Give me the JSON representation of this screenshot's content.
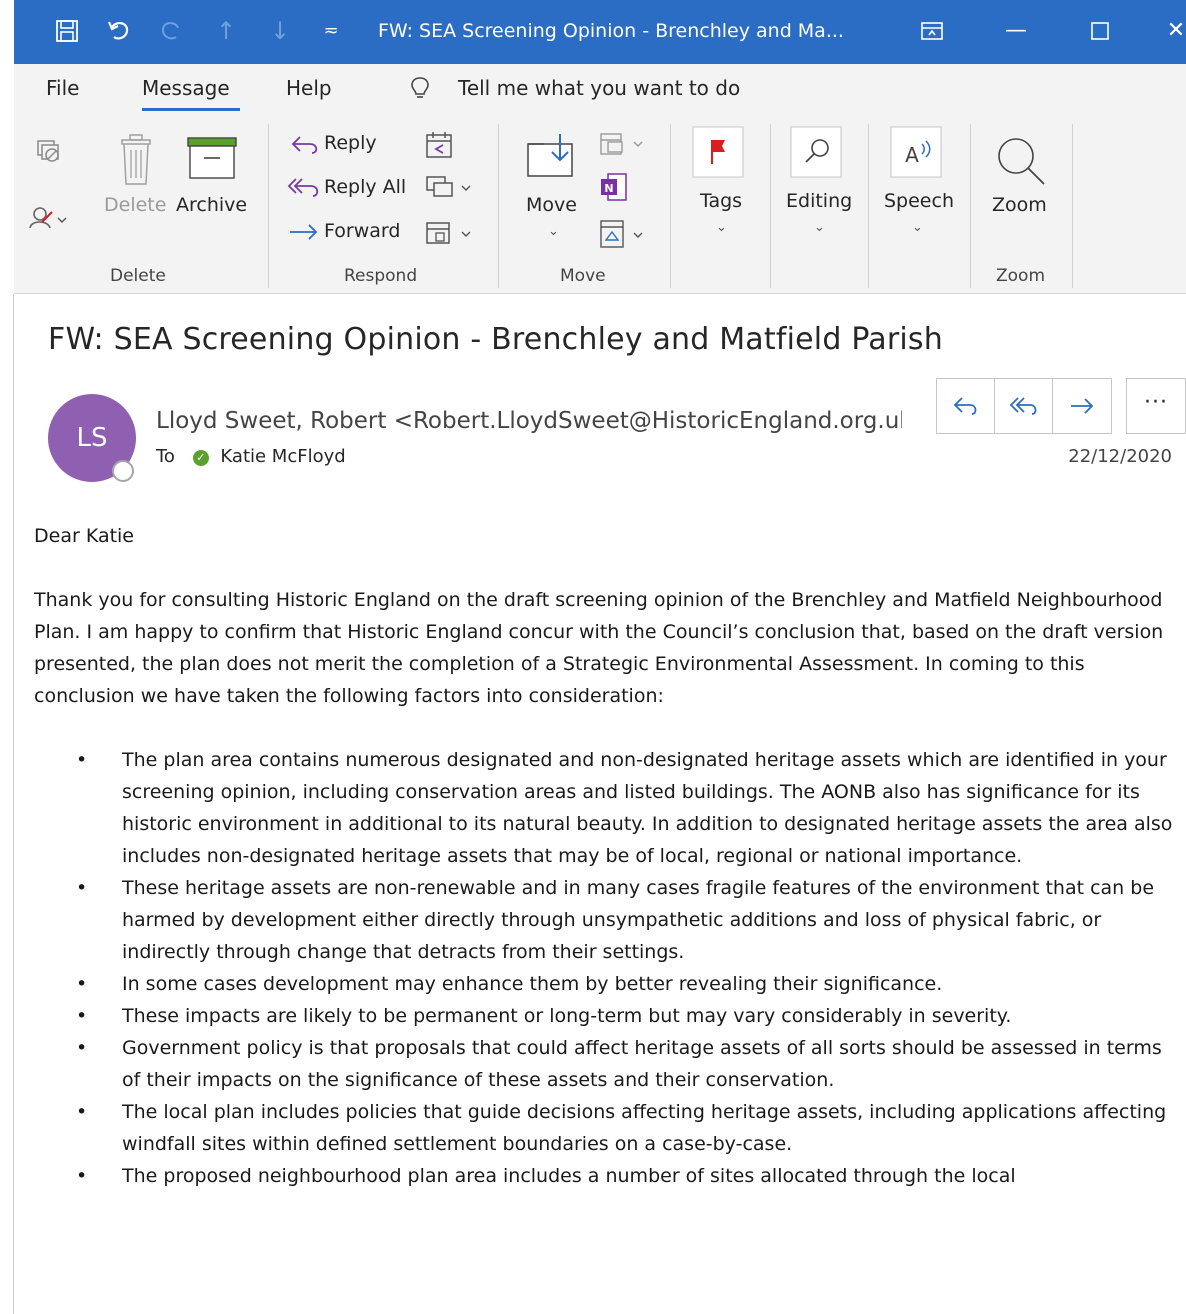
{
  "window": {
    "title": "FW: SEA Screening Opinion - Brenchley and Ma...",
    "quick_access": [
      "save-icon",
      "undo-icon",
      "redo-icon",
      "up-arrow-icon",
      "down-arrow-icon",
      "customize-icon"
    ]
  },
  "menu": {
    "tabs": [
      "File",
      "Message",
      "Help"
    ],
    "active_tab": "Message",
    "tell_me": "Tell me what you want to do"
  },
  "ribbon": {
    "delete_group": {
      "label": "Delete",
      "delete_btn": "Delete",
      "archive_btn": "Archive"
    },
    "respond_group": {
      "label": "Respond",
      "reply": "Reply",
      "reply_all": "Reply All",
      "forward": "Forward"
    },
    "move_group": {
      "label": "Move",
      "move_btn": "Move"
    },
    "tags": "Tags",
    "editing": "Editing",
    "speech": "Speech",
    "zoom_group": {
      "label": "Zoom",
      "zoom_btn": "Zoom"
    }
  },
  "message": {
    "subject": "FW: SEA Screening Opinion - Brenchley and Matfield Parish",
    "avatar_initials": "LS",
    "sender": "Lloyd Sweet, Robert <Robert.LloydSweet@HistoricEngland.org.uk>",
    "to_label": "To",
    "recipient": "Katie McFloyd",
    "date": "22/12/2020",
    "greeting": "Dear Katie",
    "paragraph": "Thank you for consulting Historic England on the draft screening opinion of the Brenchley and Matfield Neighbourhood Plan. I am happy to confirm that Historic England concur with the Council’s conclusion that, based on the draft version presented, the plan does not merit the completion of a Strategic Environmental Assessment. In coming to this conclusion we have taken the following factors into consideration:",
    "bullets": [
      "The plan area contains numerous designated and non-designated heritage assets which are identified in your screening opinion, including conservation areas and listed buildings. The AONB also has significance for its historic environment in additional to its natural beauty. In addition to designated heritage assets the area also includes non-designated heritage assets that may be of local, regional or national importance.",
      "These heritage assets are non-renewable and in many cases fragile features of the environment that can be harmed by development either directly through unsympathetic additions and loss of physical fabric, or indirectly through change that detracts from their settings.",
      "In some cases development may enhance them by better revealing their significance.",
      "These impacts are likely to be permanent or long-term but may vary considerably in severity.",
      "Government policy is that proposals that could affect heritage assets of all sorts should be assessed in terms of their impacts on the significance of these assets and their conservation.",
      "The local plan includes policies that guide decisions affecting heritage assets, including applications affecting windfall sites within defined settlement boundaries on a case-by-case.",
      "The proposed neighbourhood plan area includes a number of sites allocated through the local"
    ]
  },
  "colors": {
    "titlebar": "#2b6cc4",
    "ribbon_bg": "#f3f3f3",
    "avatar": "#8f5fb2",
    "accent": "#2b6cc4",
    "tags_flag": "#d81e1e",
    "onenote": "#7b2fa6",
    "presence_ok": "#5aa02c"
  }
}
